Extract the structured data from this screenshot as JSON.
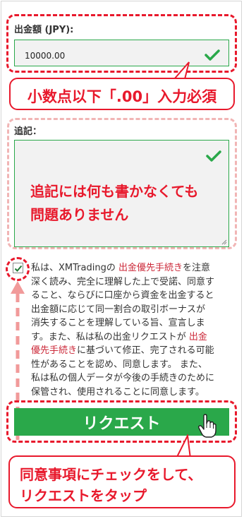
{
  "withdraw": {
    "amount_label": "出金額 (JPY):",
    "amount_value": "10000.00",
    "callout": "小数点以下「.00」入力必須"
  },
  "note": {
    "label": "追記：",
    "annotation_line1": "追記には何も書かなくても",
    "annotation_line2": "問題ありません"
  },
  "consent": {
    "checked": true,
    "lines": [
      [
        "私は、XMTradingの ",
        "出金優先手続き",
        "を注意"
      ],
      [
        "深く読み、完全に理解した上で受諾、同意す"
      ],
      [
        "ること、ならびに口座から資金を出金すると"
      ],
      [
        "出金額に応じて同一割合の取引ボーナスが"
      ],
      [
        "消失することを理解している旨、宣言しま"
      ],
      [
        "す。また、私は私の出金リクエストが ",
        "出金"
      ],
      [
        "優先手続き",
        "に基づいて修正、完了される可能"
      ],
      [
        "性があることを認め、同意します。 また、"
      ],
      [
        "私は私の個人データが今後の手続きのために"
      ],
      [
        "保管され、使用されることに同意します。"
      ]
    ]
  },
  "request_button": {
    "label": "リクエスト"
  },
  "bottom_callout": {
    "line1": "同意事項にチェックをして、",
    "line2": "リクエストをタップ"
  },
  "colors": {
    "accent_green": "#2aa84a",
    "annotation_red": "#e8192c",
    "link_red": "#cc2a3a"
  }
}
